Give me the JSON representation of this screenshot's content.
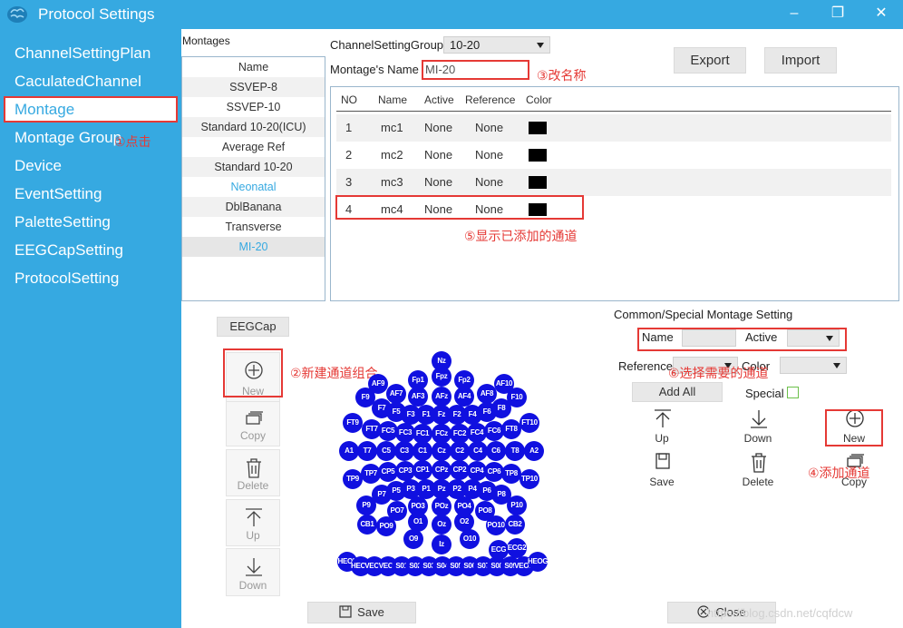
{
  "window": {
    "title": "Protocol Settings",
    "minimize": "–",
    "maximize": "❐",
    "close": "✕"
  },
  "sidebar": {
    "items": [
      {
        "label": "ChannelSettingPlan"
      },
      {
        "label": "CaculatedChannel"
      },
      {
        "label": "Montage"
      },
      {
        "label": "Montage Group"
      },
      {
        "label": "Device"
      },
      {
        "label": "EventSetting"
      },
      {
        "label": "PaletteSetting"
      },
      {
        "label": "EEGCapSetting"
      },
      {
        "label": "ProtocolSetting"
      }
    ],
    "active_index": 2
  },
  "montages": {
    "header": "Montages",
    "column": "Name",
    "items": [
      "SSVEP-8",
      "SSVEP-10",
      "Standard 10-20(ICU)",
      "Average Ref",
      "Standard 10-20",
      "Neonatal",
      "DblBanana",
      "Transverse",
      "MI-20"
    ],
    "selected": "MI-20"
  },
  "form": {
    "group_label": "ChannelSettingGroup",
    "group_value": "10-20",
    "name_label": "Montage's Name",
    "name_value": "MI-20",
    "export_label": "Export",
    "import_label": "Import"
  },
  "channels": {
    "headers": [
      "NO",
      "Name",
      "Active",
      "Reference",
      "Color"
    ],
    "rows": [
      {
        "no": "1",
        "name": "mc1",
        "active": "None",
        "reference": "None",
        "color": "#000000"
      },
      {
        "no": "2",
        "name": "mc2",
        "active": "None",
        "reference": "None",
        "color": "#000000"
      },
      {
        "no": "3",
        "name": "mc3",
        "active": "None",
        "reference": "None",
        "color": "#000000"
      },
      {
        "no": "4",
        "name": "mc4",
        "active": "None",
        "reference": "None",
        "color": "#000000"
      }
    ]
  },
  "cap": {
    "button": "EEGCap",
    "tools": [
      "New",
      "Copy",
      "Delete",
      "Up",
      "Down"
    ],
    "electrodes": [
      "Nz",
      "AF9",
      "Fp1",
      "Fpz",
      "Fp2",
      "AF10",
      "AF7",
      "AF3",
      "AFz",
      "AF4",
      "AF8",
      "F9",
      "F7",
      "F5",
      "F3",
      "F1",
      "Fz",
      "F2",
      "F4",
      "F6",
      "F8",
      "F10",
      "FT9",
      "FT7",
      "FC5",
      "FC3",
      "FC1",
      "FCz",
      "FC2",
      "FC4",
      "FC6",
      "FT8",
      "FT10",
      "A1",
      "T7",
      "C5",
      "C3",
      "C1",
      "Cz",
      "C2",
      "C4",
      "C6",
      "T8",
      "A2",
      "TP9",
      "TP7",
      "CP5",
      "CP3",
      "CP1",
      "CPz",
      "CP2",
      "CP4",
      "CP6",
      "TP8",
      "TP10",
      "P7",
      "P5",
      "P3",
      "P1",
      "Pz",
      "P2",
      "P4",
      "P6",
      "P8",
      "P9",
      "PO7",
      "PO3",
      "POz",
      "PO4",
      "PO8",
      "P10",
      "CB1",
      "PO9",
      "O1",
      "Oz",
      "O2",
      "PO10",
      "CB2",
      "O9",
      "Iz",
      "O10",
      "ECG",
      "ECG2",
      "HEOL",
      "HEOR",
      "VEOU",
      "VEOL",
      "S01",
      "S02",
      "S03",
      "S04",
      "S05",
      "S06",
      "S07",
      "S08",
      "S09",
      "VEOR",
      "HEOG"
    ]
  },
  "common": {
    "title": "Common/Special Montage Setting",
    "name_label": "Name",
    "active_label": "Active",
    "reference_label": "Reference",
    "color_label": "Color",
    "add_all": "Add All",
    "special_label": "Special",
    "up": "Up",
    "down": "Down",
    "new": "New",
    "save": "Save",
    "delete": "Delete",
    "copy": "Copy"
  },
  "footer": {
    "save": "Save",
    "close": "Close"
  },
  "annotations": {
    "a1": "①点击",
    "a2": "②新建通道组合",
    "a3": "③改名称",
    "a4": "④添加通道",
    "a5": "⑤显示已添加的通道",
    "a6": "⑥选择需要的通道"
  },
  "watermark": "https://blog.csdn.net/cqfdcw"
}
